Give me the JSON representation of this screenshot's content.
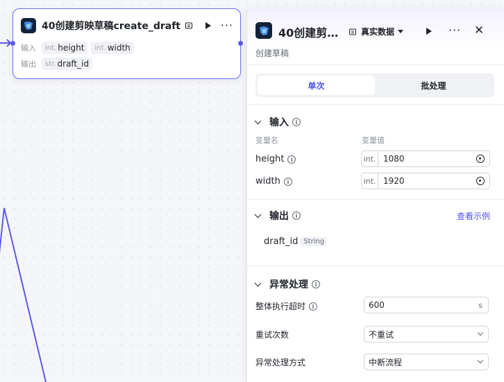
{
  "canvas": {
    "node": {
      "title": "40创建剪映草稿create_draft",
      "input_label": "输入",
      "output_label": "输出",
      "inputs": [
        {
          "type": "int.",
          "name": "height"
        },
        {
          "type": "int.",
          "name": "width"
        }
      ],
      "outputs": [
        {
          "type": "str.",
          "name": "draft_id"
        }
      ]
    }
  },
  "panel": {
    "title": "40创建剪…",
    "env_select": "真实数据",
    "description": "创建草稿",
    "tabs": [
      {
        "label": "单次",
        "active": true
      },
      {
        "label": "批处理",
        "active": false
      }
    ],
    "input_section": {
      "title": "输入",
      "col_name": "变量名",
      "col_value": "变量值",
      "vars": [
        {
          "name": "height",
          "type": "int.",
          "value": "1080"
        },
        {
          "name": "width",
          "type": "int.",
          "value": "1920"
        }
      ]
    },
    "output_section": {
      "title": "输出",
      "view_example": "查看示例",
      "vars": [
        {
          "name": "draft_id",
          "type": "String"
        }
      ]
    },
    "exception_section": {
      "title": "异常处理",
      "timeout_label": "整体执行超时",
      "timeout_value": "600",
      "timeout_unit": "s",
      "retry_label": "重试次数",
      "retry_value": "不重试",
      "handling_label": "异常处理方式",
      "handling_value": "中断流程"
    }
  },
  "colors": {
    "accent": "#4d53e8",
    "node_border": "#6e6cf5",
    "edge": "#5c5ae8"
  }
}
